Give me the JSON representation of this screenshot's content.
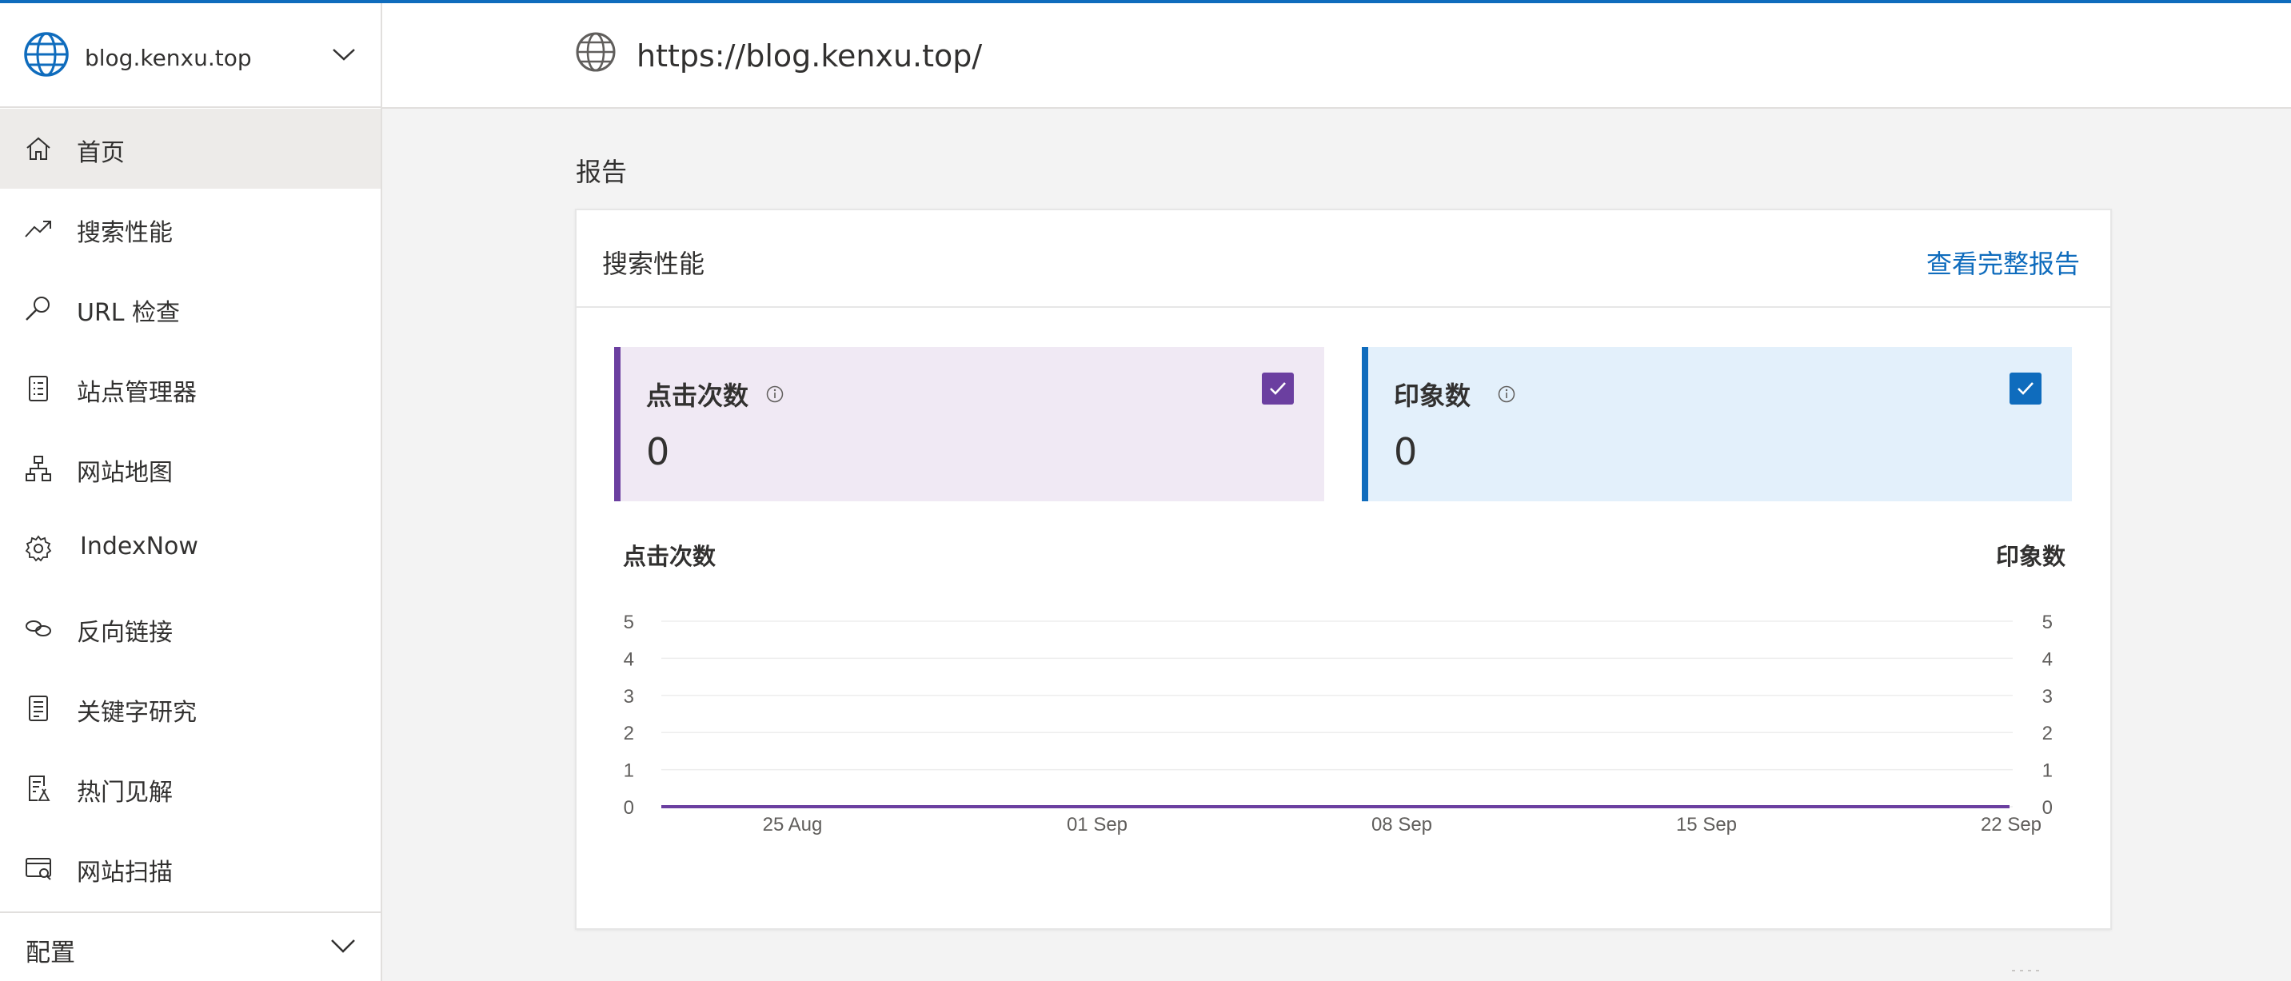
{
  "site": {
    "name": "blog.kenxu.top",
    "url": "https://blog.kenxu.top/"
  },
  "nav": {
    "items": [
      {
        "label": "首页",
        "icon": "home-icon",
        "active": true
      },
      {
        "label": "搜索性能",
        "icon": "trending-icon"
      },
      {
        "label": "URL 检查",
        "icon": "search-icon"
      },
      {
        "label": "站点管理器",
        "icon": "document-list-icon"
      },
      {
        "label": "网站地图",
        "icon": "sitemap-icon"
      },
      {
        "label": "IndexNow",
        "icon": "gear-icon"
      },
      {
        "label": "反向链接",
        "icon": "link-icon"
      },
      {
        "label": "关键字研究",
        "icon": "document-icon"
      },
      {
        "label": "热门见解",
        "icon": "insights-icon"
      },
      {
        "label": "网站扫描",
        "icon": "scan-icon"
      }
    ],
    "config_label": "配置"
  },
  "main": {
    "section_title": "报告",
    "card": {
      "title": "搜索性能",
      "link": "查看完整报告",
      "metrics": [
        {
          "label": "点击次数",
          "value": "0",
          "checked": true,
          "color": "#6b3fa0"
        },
        {
          "label": "印象数",
          "value": "0",
          "checked": true,
          "color": "#0f6cbd"
        }
      ]
    }
  },
  "chart_data": {
    "type": "line",
    "left_axis_label": "点击次数",
    "right_axis_label": "印象数",
    "y_ticks": [
      0,
      1,
      2,
      3,
      4,
      5
    ],
    "ylim": [
      0,
      5
    ],
    "x_tick_labels": [
      "25 Aug",
      "01 Sep",
      "08 Sep",
      "15 Sep",
      "22 Sep"
    ],
    "series": [
      {
        "name": "点击次数",
        "color": "#6b3fa0",
        "values": [
          0,
          0,
          0,
          0,
          0
        ]
      },
      {
        "name": "印象数",
        "color": "#0f6cbd",
        "values": [
          0,
          0,
          0,
          0,
          0
        ]
      }
    ],
    "grid": true
  }
}
